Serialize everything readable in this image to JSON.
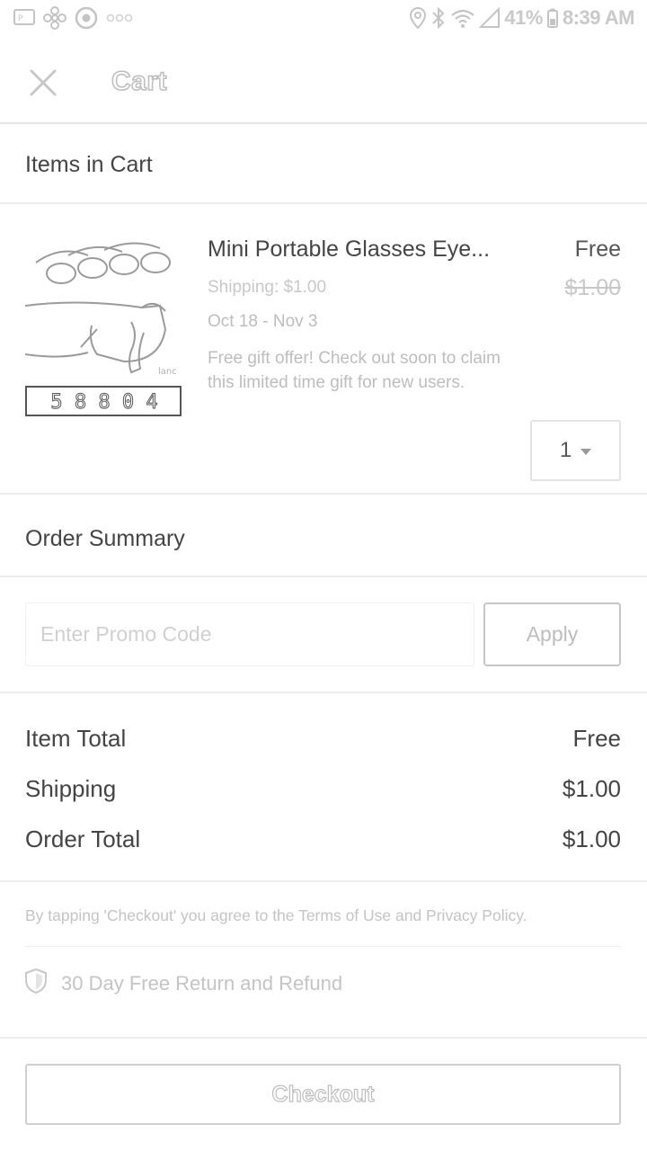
{
  "status_bar": {
    "battery": "41%",
    "time": "8:39 AM",
    "left_icons": [
      "message-icon",
      "pinwheel-icon",
      "record-icon",
      "more-dots-icon"
    ],
    "right_icons": [
      "location-icon",
      "bluetooth-icon",
      "wifi-icon",
      "signal-icon",
      "battery-icon"
    ]
  },
  "header": {
    "title": "Cart",
    "close_icon": "close-icon"
  },
  "items_section": {
    "heading": "Items in Cart"
  },
  "cart_item": {
    "name": "Mini Portable Glasses Eye...",
    "price": "Free",
    "original_price": "$1.00",
    "shipping": "Shipping: $1.00",
    "dates": "Oct 18 - Nov 3",
    "gift_offer": "Free gift offer! Check out soon to claim this limited time gift for new users.",
    "quantity": "1",
    "image_digits": "5 8 8 0 4"
  },
  "order_summary": {
    "heading": "Order Summary",
    "promo_placeholder": "Enter Promo Code",
    "apply_label": "Apply",
    "rows": [
      {
        "label": "Item Total",
        "value": "Free"
      },
      {
        "label": "Shipping",
        "value": "$1.00"
      },
      {
        "label": "Order Total",
        "value": "$1.00"
      }
    ]
  },
  "terms_text": "By tapping 'Checkout' you agree to the Terms of Use and Privacy Policy.",
  "return_policy": {
    "icon": "shield-icon",
    "text": "30 Day Free Return and Refund"
  },
  "checkout_label": "Checkout",
  "colors": {
    "text": "#444444",
    "muted": "#c4c4c4",
    "border": "#e6e6e6"
  }
}
